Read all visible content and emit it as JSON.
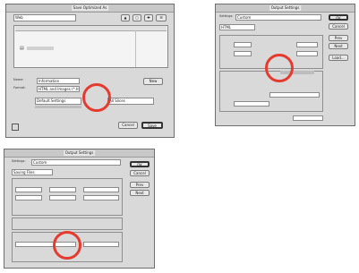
{
  "dialog1": {
    "title": "Save Optimized As",
    "location": "Web",
    "file_name_label": "Name:",
    "file_name": "Information",
    "format_label": "Format:",
    "format": "HTML and Images (*.html)",
    "settings": "Default Settings",
    "slices": "All Slices",
    "cancel": "Cancel",
    "save": "Save",
    "new": "New"
  },
  "dialog2": {
    "title": "Output Settings",
    "settings_label": "Settings:",
    "settings": "Custom",
    "section": "HTML",
    "ok": "OK",
    "cancel": "Cancel",
    "prev": "Prev",
    "next": "Next",
    "load": "Load..."
  },
  "dialog3": {
    "title": "Output Settings",
    "settings_label": "Settings:",
    "settings": "Custom",
    "section": "Saving Files",
    "ok": "OK",
    "cancel": "Cancel",
    "prev": "Prev",
    "next": "Next"
  }
}
